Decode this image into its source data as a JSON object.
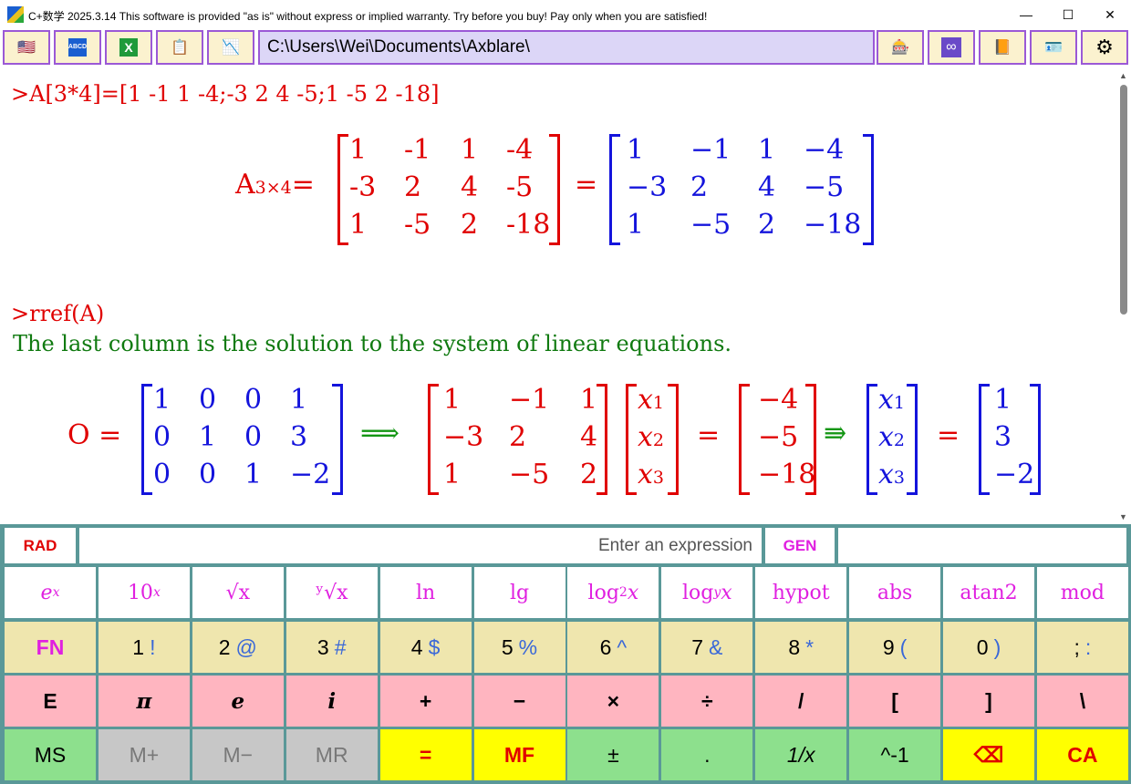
{
  "window": {
    "title": "C+数学 2025.3.14 This software is provided \"as is\" without express or implied warranty. Try before you buy! Pay only when you are satisfied!",
    "minimize": "—",
    "maximize": "☐",
    "close": "✕"
  },
  "toolbar": {
    "path": "C:\\Users\\Wei\\Documents\\Axblare\\",
    "left_icons": [
      "flag-icon",
      "abcd-icon",
      "excel-icon",
      "clipboard-icon",
      "chart-icon"
    ],
    "right_icons": [
      "calculator-icon",
      "infinity-icon",
      "book-icon",
      "card-icon",
      "gear-icon"
    ],
    "glyphs": {
      "flag": "🇺🇸",
      "abcd": "ABCD",
      "excel": "X",
      "clipboard": "📋",
      "chart": "📉",
      "calc": "🎰",
      "infinity": "∞",
      "book": "📙",
      "card": "🪪",
      "gear": "⚙"
    }
  },
  "output": {
    "cmd1": ">A[3*4]=[1 -1 1 -4;-3 2 4 -5;1 -5 2 -18]",
    "a_label": "A",
    "a_sub": "3×4",
    "eq": "=",
    "matA_input": [
      [
        "1",
        "-1",
        "1",
        "-4"
      ],
      [
        "-3",
        "2",
        "4",
        "-5"
      ],
      [
        "1",
        "-5",
        "2",
        "-18"
      ]
    ],
    "matA_display": [
      [
        "1",
        "−1",
        "1",
        "−4"
      ],
      [
        "−3",
        "2",
        "4",
        "−5"
      ],
      [
        "1",
        "−5",
        "2",
        "−18"
      ]
    ],
    "cmd2": ">rref(A)",
    "note": "The last column is the solution to the system of linear equations.",
    "o_label": "O =",
    "matO": [
      [
        "1",
        "0",
        "0",
        "1"
      ],
      [
        "0",
        "1",
        "0",
        "3"
      ],
      [
        "0",
        "0",
        "1",
        "−2"
      ]
    ],
    "implies": "⟹",
    "implies2": "⇛",
    "matCoef": [
      [
        "1",
        "−1",
        "1"
      ],
      [
        "−3",
        "2",
        "4"
      ],
      [
        "1",
        "−5",
        "2"
      ]
    ],
    "vars": [
      "x",
      "x",
      "x"
    ],
    "var_subs": [
      "1",
      "2",
      "3"
    ],
    "rhs": [
      "−4",
      "−5",
      "−18"
    ],
    "solution": [
      "1",
      "3",
      "−2"
    ]
  },
  "inputrow": {
    "mode": "RAD",
    "placeholder": "Enter an expression",
    "gen": "GEN",
    "extra": ""
  },
  "fn_keys": [
    {
      "base": "e",
      "sup": "x"
    },
    {
      "base": "10",
      "sup": "x"
    },
    {
      "label": "√x"
    },
    {
      "label": "ʸ√x"
    },
    {
      "label": "ln"
    },
    {
      "label": "lg"
    },
    {
      "base": "log",
      "sub": "2",
      "tail": "x"
    },
    {
      "base": "log",
      "sub": "y",
      "tail": "x"
    },
    {
      "label": "hypot"
    },
    {
      "label": "abs"
    },
    {
      "label": "atan2"
    },
    {
      "label": "mod"
    }
  ],
  "num_keys": [
    {
      "main": "FN",
      "alt": ""
    },
    {
      "main": "1",
      "alt": "!"
    },
    {
      "main": "2",
      "alt": "@"
    },
    {
      "main": "3",
      "alt": "#"
    },
    {
      "main": "4",
      "alt": "$"
    },
    {
      "main": "5",
      "alt": "%"
    },
    {
      "main": "6",
      "alt": "^"
    },
    {
      "main": "7",
      "alt": "&"
    },
    {
      "main": "8",
      "alt": "*"
    },
    {
      "main": "9",
      "alt": "("
    },
    {
      "main": "0",
      "alt": ")"
    },
    {
      "main": ";",
      "alt": ":"
    }
  ],
  "op_keys": [
    "E",
    "π",
    "e",
    "i",
    "+",
    "−",
    "×",
    "÷",
    "/",
    "[",
    "]",
    "\\"
  ],
  "bottom_keys": [
    "MS",
    "M+",
    "M−",
    "MR",
    "=",
    "MF",
    "±",
    ".",
    "1/x",
    "^-1",
    "⌫",
    "CA"
  ]
}
